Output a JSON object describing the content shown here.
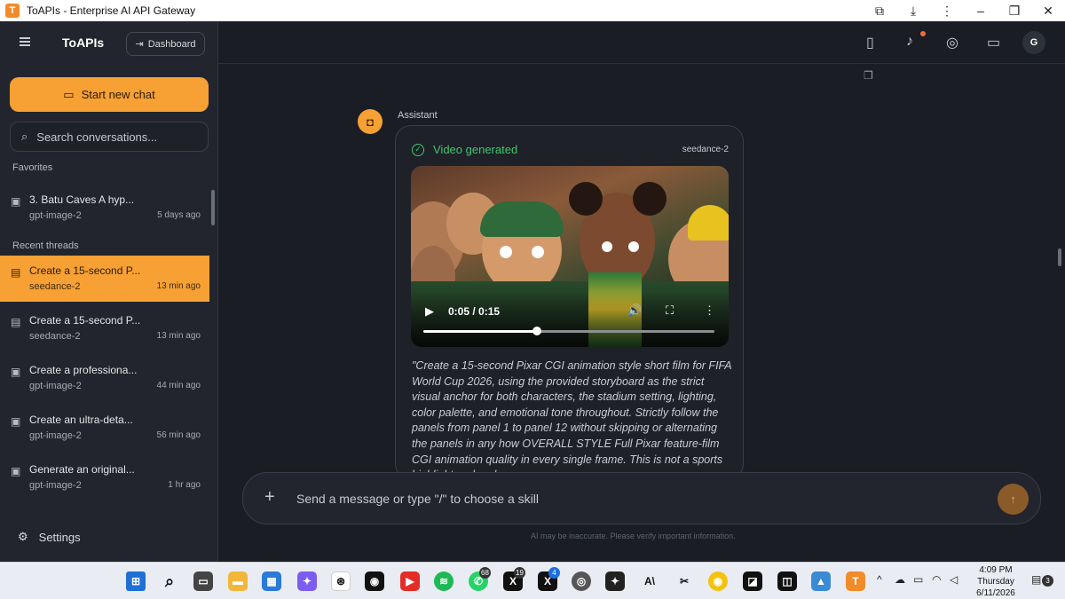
{
  "window": {
    "title": "ToAPIs - Enterprise AI API Gateway",
    "app_letter": "T"
  },
  "sidebar": {
    "brand": "ToAPIs",
    "dashboard_label": "Dashboard",
    "new_chat_label": "Start new chat",
    "search_placeholder": "Search conversations...",
    "favorites_label": "Favorites",
    "favorites": [
      {
        "title": "3. Batu Caves A hyp...",
        "model": "gpt-image-2",
        "time": "5 days ago",
        "icon": "image-icon"
      }
    ],
    "recent_label": "Recent threads",
    "recent": [
      {
        "title": "Create a 15-second P...",
        "model": "seedance-2",
        "time": "13 min ago",
        "icon": "video-icon",
        "active": true
      },
      {
        "title": "Create a 15-second P...",
        "model": "seedance-2",
        "time": "13 min ago",
        "icon": "video-icon"
      },
      {
        "title": "Create a professiona...",
        "model": "gpt-image-2",
        "time": "44 min ago",
        "icon": "image-icon"
      },
      {
        "title": "Create an ultra-deta...",
        "model": "gpt-image-2",
        "time": "56 min ago",
        "icon": "image-icon"
      },
      {
        "title": "Generate an original...",
        "model": "gpt-image-2",
        "time": "1 hr ago",
        "icon": "image-icon"
      }
    ],
    "settings_label": "Settings"
  },
  "header": {
    "avatar_initial": "G"
  },
  "message": {
    "role_label": "Assistant",
    "status": "Video generated",
    "model": "seedance-2",
    "video": {
      "time": "0:05 / 0:15",
      "progress": 0.39
    },
    "prompt": "\"Create a 15-second Pixar CGI animation style short film for FIFA World Cup 2026, using the provided storyboard as the strict visual anchor for both characters, the stadium setting, lighting, color palette, and emotional tone throughout. Strictly follow the panels from panel 1 to panel 12 without skipping or alternating the panels in any how OVERALL STYLE Full Pixar feature-film CGI animation quality in every single frame. This is not a sports highlight reel and"
  },
  "composer": {
    "placeholder": "Send a message or type \"/\" to choose a skill",
    "disclaimer": "AI may be inaccurate. Please verify important information."
  },
  "taskbar": {
    "badges": {
      "whatsapp": "68",
      "x1": "19",
      "x2": "4",
      "notifications": "3"
    },
    "clock": {
      "time": "4:09 PM",
      "day": "Thursday",
      "date": "6/11/2026"
    }
  },
  "colors": {
    "accent": "#f7a033",
    "success": "#42c66f",
    "background": "#1a1d24",
    "sidebar": "#22252d"
  }
}
